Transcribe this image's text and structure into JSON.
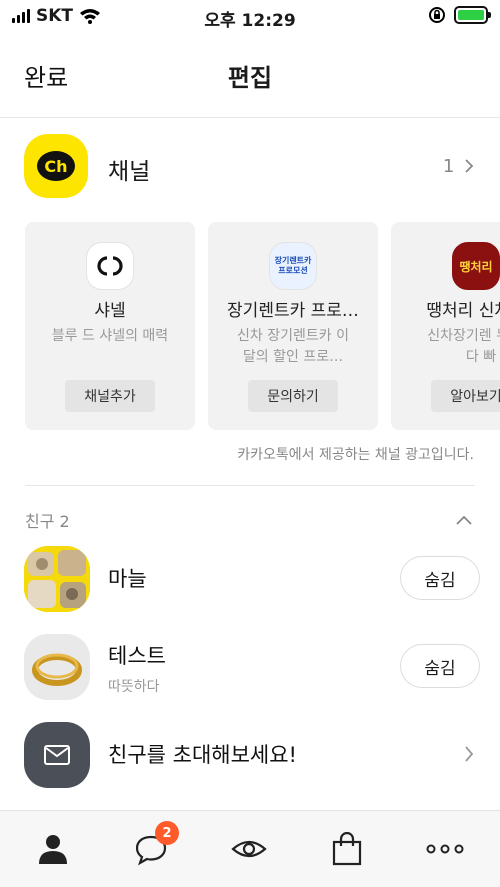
{
  "status_bar": {
    "carrier": "SKT",
    "time": "오후 12:29"
  },
  "header": {
    "done_label": "완료",
    "title": "편집"
  },
  "channel": {
    "label": "채널",
    "count": "1",
    "logo_text": "Ch",
    "cards": [
      {
        "name": "샤넬",
        "desc": "블루 드 샤넬의 매력",
        "button": "채널추가",
        "logo_text": "CC"
      },
      {
        "name": "장기렌트카 프로…",
        "desc": "신차 장기렌트카 이달의 할인 프로…",
        "button": "문의하기",
        "logo_text": "장기렌트카 프로모션"
      },
      {
        "name": "땡처리 신차장",
        "desc": "신차장기렌 누구보다 빠",
        "button": "알아보기",
        "logo_text": "땡처리"
      }
    ],
    "ad_note": "카카오톡에서 제공하는 채널 광고입니다."
  },
  "friends": {
    "header": "친구 2",
    "items": [
      {
        "name": "마늘",
        "status": "",
        "button": "숨김"
      },
      {
        "name": "테스트",
        "status": "따뜻하다",
        "button": "숨김"
      }
    ],
    "invite_label": "친구를 초대해보세요!"
  },
  "tabbar": {
    "chat_badge": "2",
    "tabs": [
      "friends",
      "chats",
      "view",
      "shopping",
      "more"
    ]
  },
  "colors": {
    "kakao_yellow": "#fee500",
    "badge": "#ff5a2a",
    "battery_green": "#2fcf45"
  }
}
